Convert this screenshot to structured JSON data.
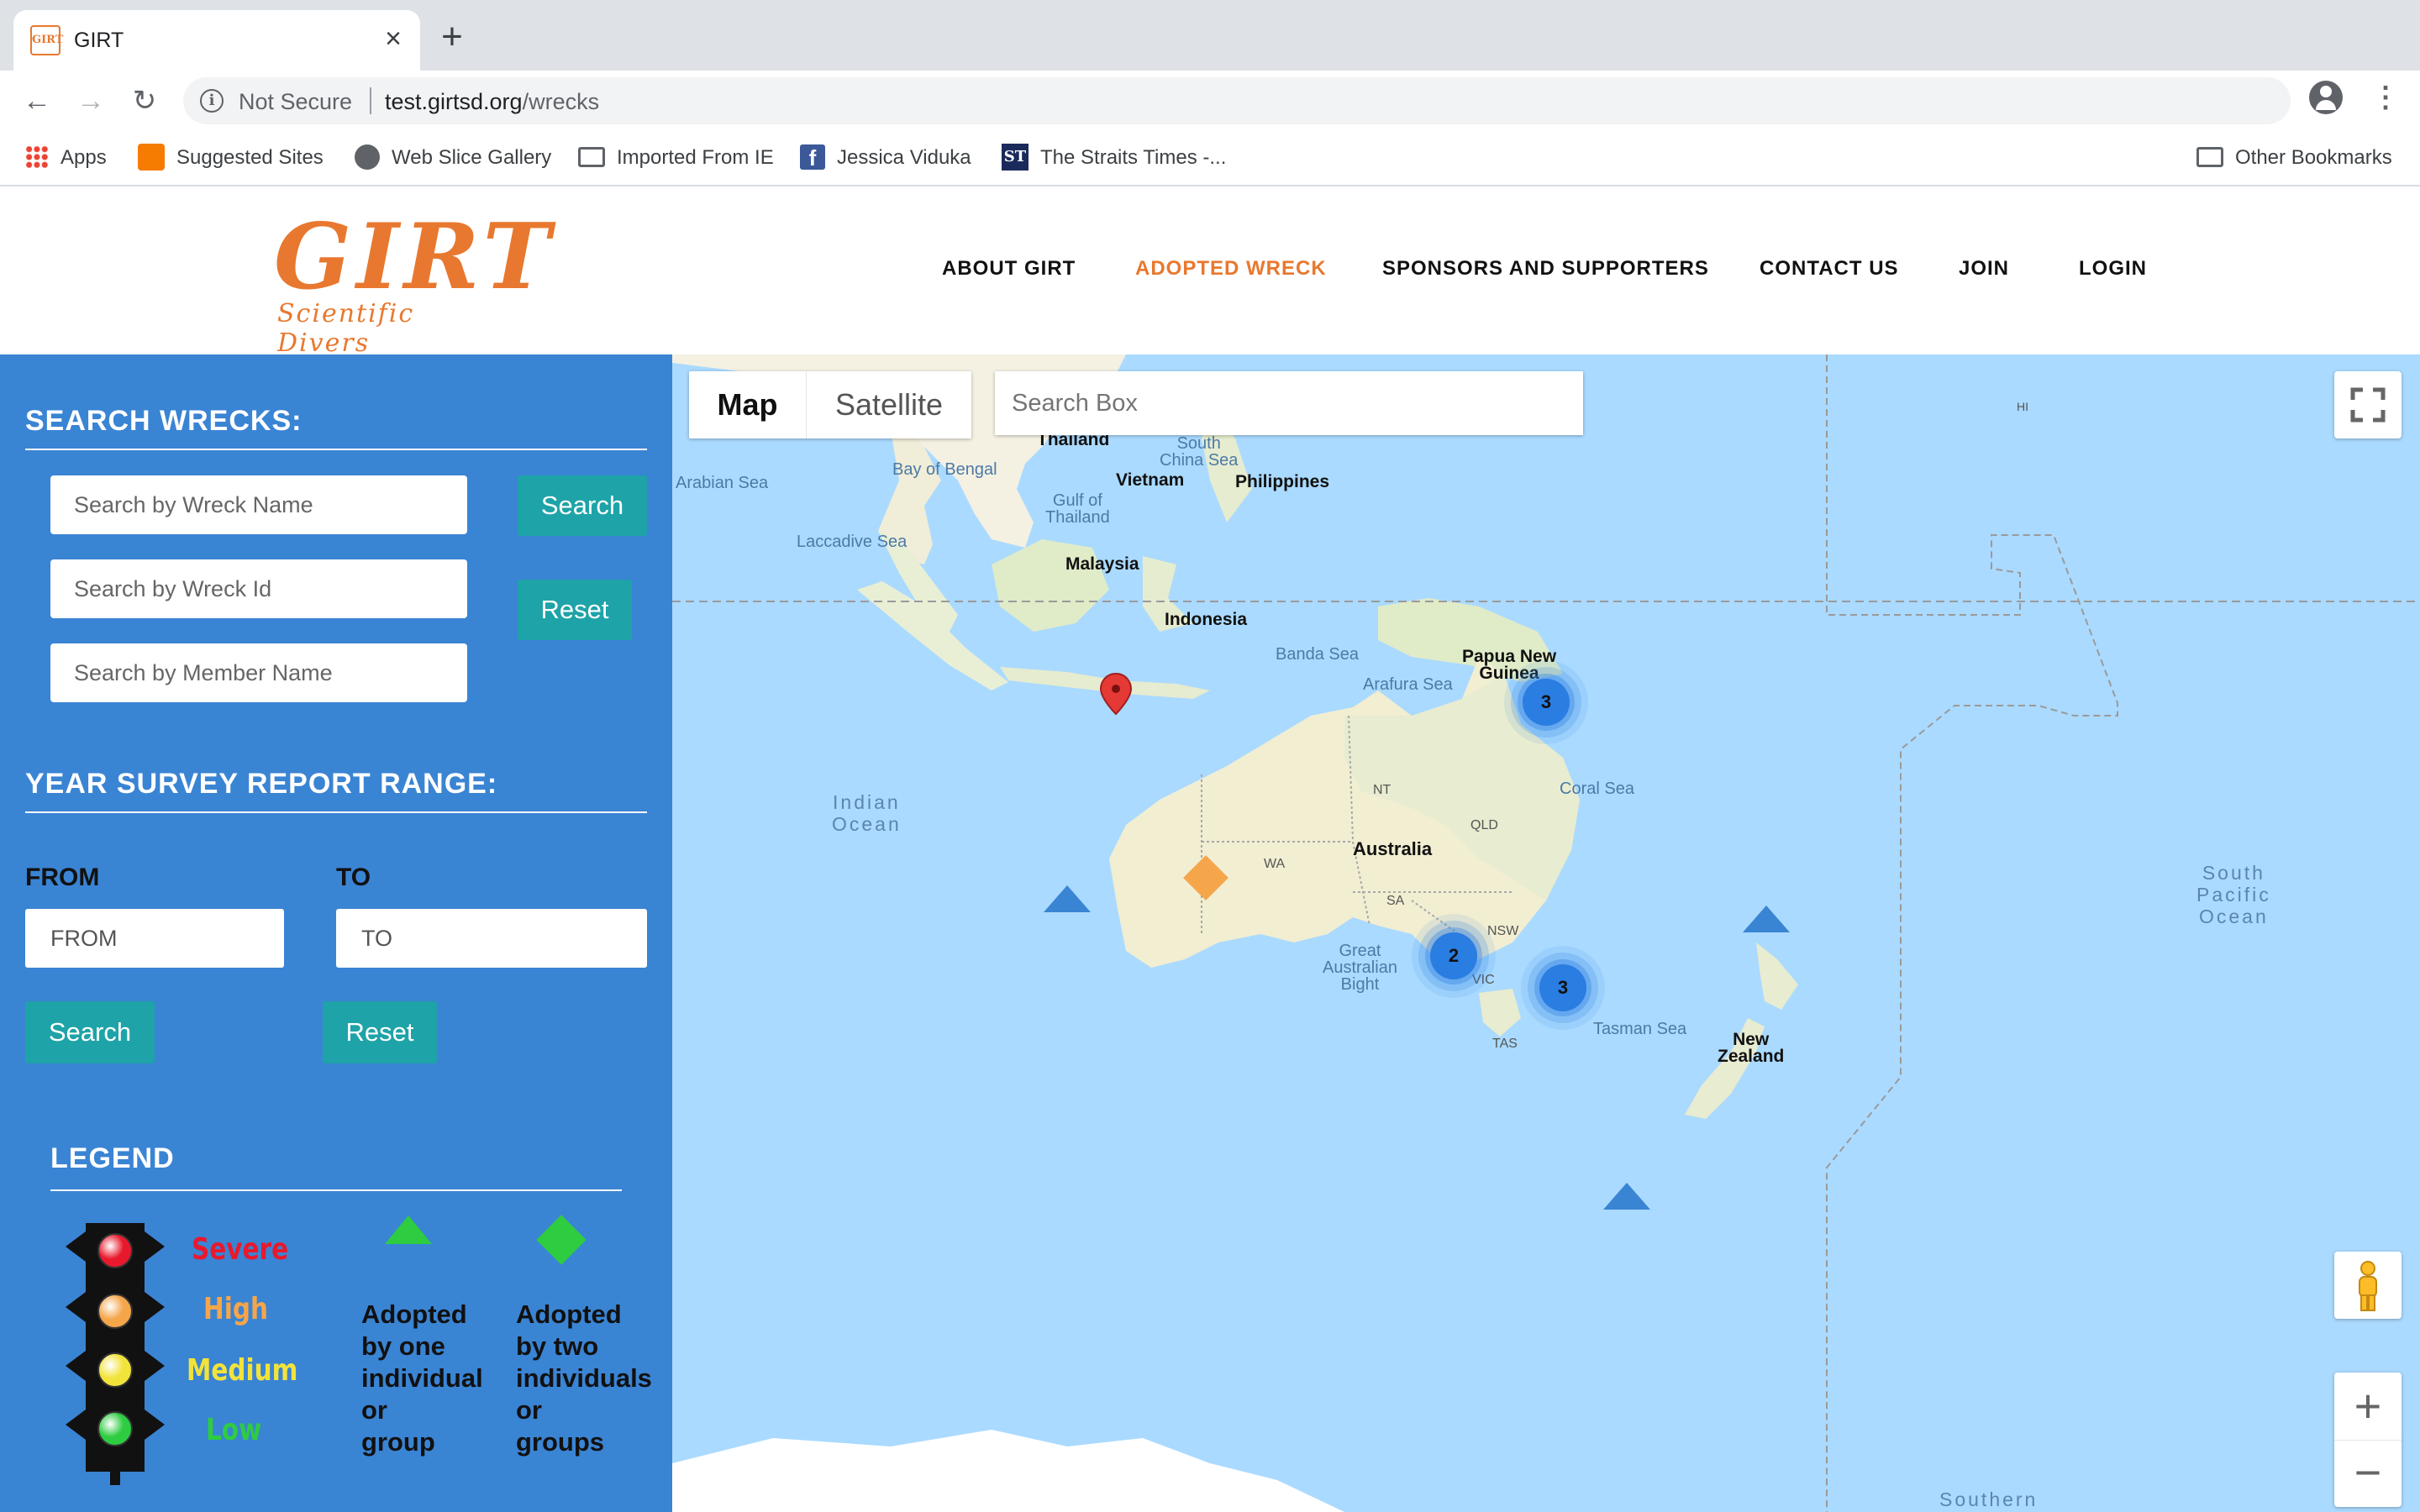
{
  "browser": {
    "tab_title": "GIRT",
    "tab_favicon_text": "GIRT",
    "close_glyph": "×",
    "new_tab_glyph": "+",
    "not_secure": "Not Secure",
    "url_host": "test.girtsd.org",
    "url_path": "/wrecks",
    "back_glyph": "←",
    "forward_glyph": "→",
    "reload_glyph": "↻",
    "info_glyph": "i",
    "star_glyph": "☆",
    "menu_glyph": "⋮",
    "bookmarks": [
      {
        "label": "Apps",
        "icon": "apps-icon"
      },
      {
        "label": "Suggested Sites",
        "icon": "suggested-sites-icon"
      },
      {
        "label": "Web Slice Gallery",
        "icon": "globe-icon"
      },
      {
        "label": "Imported From IE",
        "icon": "folder-icon"
      },
      {
        "label": "Jessica Viduka",
        "icon": "facebook-icon"
      },
      {
        "label": "The Straits Times -...",
        "icon": "straits-times-icon"
      }
    ],
    "other_bookmarks": "Other Bookmarks",
    "fb_glyph": "f",
    "st_glyph": "ST"
  },
  "site": {
    "logo_main": "GIRT",
    "logo_sub": "Scientific Divers",
    "nav": [
      "ABOUT GIRT",
      "ADOPTED WRECK",
      "SPONSORS AND SUPPORTERS",
      "CONTACT US",
      "JOIN",
      "LOGIN"
    ],
    "nav_active": "ADOPTED WRECK",
    "accent_color": "#e8782f"
  },
  "sidebar": {
    "search_title": "SEARCH WRECKS:",
    "wreck_name_placeholder": "Search by Wreck Name",
    "wreck_id_placeholder": "Search by Wreck Id",
    "member_name_placeholder": "Search by Member Name",
    "search_label": "Search",
    "reset_label": "Reset",
    "range_title": "YEAR SURVEY REPORT RANGE:",
    "from_label": "FROM",
    "to_label": "TO",
    "from_placeholder": "FROM",
    "to_placeholder": "TO",
    "range_search_label": "Search",
    "range_reset_label": "Reset",
    "bg_color": "#3a84d4",
    "button_color": "#1ea3a8"
  },
  "legend": {
    "title": "LEGEND",
    "severity": [
      {
        "label": "Severe",
        "color": "#e8192c"
      },
      {
        "label": "High",
        "color": "#f5a54a"
      },
      {
        "label": "Medium",
        "color": "#f2e33a"
      },
      {
        "label": "Low",
        "color": "#2ecc40"
      }
    ],
    "adopted_one": [
      "Adopted",
      "by one",
      "individual",
      "or",
      "group"
    ],
    "adopted_two": [
      "Adopted",
      "by two",
      "individuals",
      "or",
      "groups"
    ]
  },
  "map": {
    "type_map": "Map",
    "type_satellite": "Satellite",
    "search_placeholder": "Search Box",
    "zoom_in_glyph": "+",
    "zoom_out_glyph": "−",
    "labels": {
      "thailand": "Thailand",
      "vietnam": "Vietnam",
      "south_china_sea": "South\nChina Sea",
      "philippines": "Philippines",
      "bay_of_bengal": "Bay of Bengal",
      "arabian_sea": "Arabian Sea",
      "gulf_of_thailand": "Gulf of\nThailand",
      "laccadive_sea": "Laccadive Sea",
      "malaysia": "Malaysia",
      "indonesia": "Indonesia",
      "banda_sea": "Banda Sea",
      "arafura_sea": "Arafura Sea",
      "png": "Papua New\nGuinea",
      "coral_sea": "Coral Sea",
      "indian_ocean": "Indian\nOcean",
      "nt": "NT",
      "qld": "QLD",
      "wa": "WA",
      "australia": "Australia",
      "sa": "SA",
      "nsw": "NSW",
      "vic": "VIC",
      "tas": "TAS",
      "great_australian_bight": "Great\nAustralian\nBight",
      "tasman_sea": "Tasman Sea",
      "new_zealand": "New\nZealand",
      "south_pacific_ocean": "South\nPacific\nOcean",
      "southern": "Southern",
      "hi": "HI"
    },
    "clusters": [
      "3",
      "2",
      "3"
    ]
  }
}
